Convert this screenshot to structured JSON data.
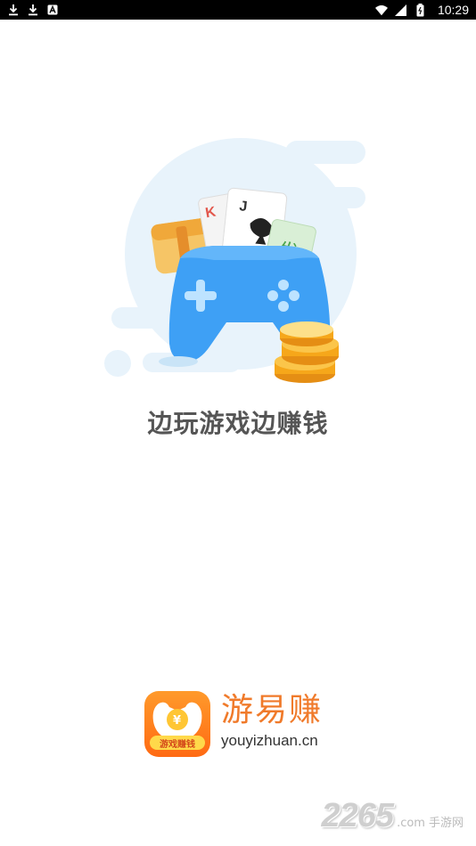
{
  "status_bar": {
    "left_icons": [
      "download-icon",
      "download-icon",
      "a-notification-icon"
    ],
    "right_icons": [
      "wifi-icon",
      "signal-icon",
      "battery-icon"
    ],
    "time": "10:29"
  },
  "splash": {
    "tagline": "边玩游戏边赚钱",
    "illustration_items": [
      "cloud",
      "treasure-chest",
      "playing-cards",
      "mahjong-tile",
      "gamepad",
      "coins"
    ],
    "playing_card_letters": [
      "K",
      "J"
    ],
    "mahjong_text": "发"
  },
  "brand": {
    "icon_badge": "游戏赚钱",
    "name": "游易赚",
    "domain": "youyizhuan.cn"
  },
  "watermark": {
    "number": "2265",
    "suffix": ".com",
    "label": "手游网"
  },
  "colors": {
    "gamepad_blue": "#3ea0f5",
    "cloud": "#e8f3fb",
    "coin": "#f6a71a",
    "brand_orange": "#f07a2a",
    "tagline": "#555555"
  }
}
